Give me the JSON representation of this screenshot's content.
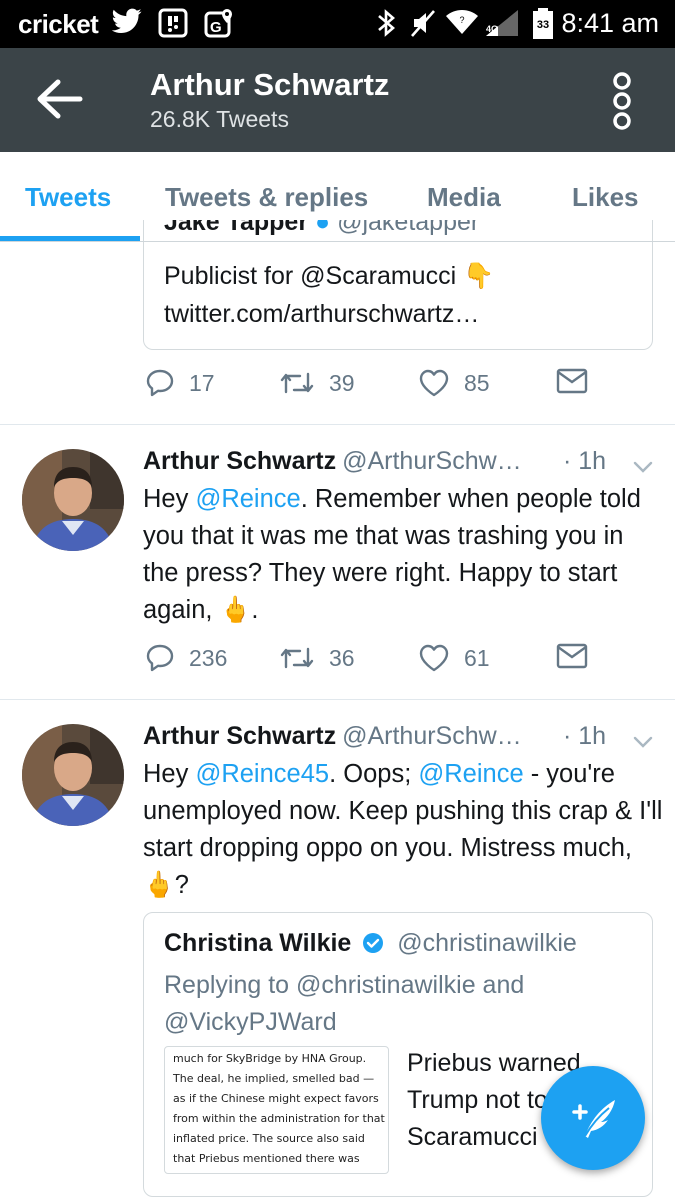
{
  "status_bar": {
    "carrier": "cricket",
    "battery_level": "33",
    "time": "8:41 am",
    "icons": [
      "twitter-icon",
      "sim-icon",
      "maps-icon",
      "bluetooth-icon",
      "mute-icon",
      "wifi-icon",
      "signal-icon",
      "battery-icon"
    ]
  },
  "header": {
    "title": "Arthur Schwartz",
    "subtitle": "26.8K Tweets",
    "background": "#3b4448"
  },
  "tabs": [
    {
      "label": "Tweets",
      "active": true
    },
    {
      "label": "Tweets & replies",
      "active": false
    },
    {
      "label": "Media",
      "active": false
    },
    {
      "label": "Likes",
      "active": false
    }
  ],
  "accent": "#1da1f2",
  "tweet1": {
    "quote_cut_name": "Jake Tapper",
    "quote_cut_handle": "@jaketapper",
    "quote_line1": "Publicist for @Scaramucci 👇",
    "quote_line2": "twitter.com/arthurschwartz…",
    "replies": "17",
    "retweets": "39",
    "likes": "85"
  },
  "tweet2": {
    "name": "Arthur Schwartz",
    "handle": "@ArthurSchw…",
    "time": "· 1h",
    "body_pre": "Hey ",
    "mention1": "@Reince",
    "body_post": ". Remember when people told you that it was me that was trashing you in the press? They were right. Happy to start again, 🖕.",
    "replies": "236",
    "retweets": "36",
    "likes": "61"
  },
  "tweet3": {
    "name": "Arthur Schwartz",
    "handle": "@ArthurSchw…",
    "time": "· 1h",
    "body_pre": "Hey ",
    "mention1": "@Reince45",
    "body_mid": ". Oops; ",
    "mention2": "@Reince",
    "body_post": " - you're unemployed now. Keep pushing this crap & I'll start dropping oppo on you. Mistress much, 🖕?",
    "quote": {
      "name": "Christina Wilkie",
      "handle": "@christinawilkie",
      "replying_to": "Replying to @christinawilkie and @VickyPJWard",
      "image_text": "much for SkyBridge by HNA Group. The deal, he implied, smelled bad — as if the Chinese might expect favors from within the administration for that inflated price. The source also said that Priebus mentioned there was email traffic between",
      "text": "Priebus warned Trump not to hire Scaramucci"
    }
  }
}
